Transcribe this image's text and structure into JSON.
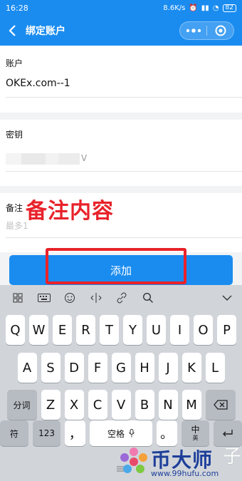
{
  "status_bar": {
    "time": "16:28",
    "net_speed": "8.6K/s",
    "battery": "82"
  },
  "header": {
    "title": "绑定账户"
  },
  "form": {
    "account": {
      "label": "账户",
      "value": "OKEx.com--1"
    },
    "secret": {
      "label": "密钥",
      "value_suffix": "V"
    },
    "note": {
      "label": "备注",
      "placeholder": "最多1"
    }
  },
  "annotation": {
    "text": "备注内容"
  },
  "submit": {
    "label": "添加"
  },
  "keyboard": {
    "row1": [
      "Q",
      "W",
      "E",
      "R",
      "T",
      "Y",
      "U",
      "I",
      "O",
      "P"
    ],
    "row2": [
      "A",
      "S",
      "D",
      "F",
      "G",
      "H",
      "J",
      "K",
      "L"
    ],
    "row3": [
      "Z",
      "X",
      "C",
      "V",
      "B",
      "N",
      "M"
    ],
    "fenci": "分词",
    "symbol": "符",
    "num": "123",
    "comma": "，",
    "space": "空格",
    "period": "。",
    "zh": "中",
    "en": "英"
  },
  "watermark": {
    "brand": "币大师",
    "url": "www.99hufu.com",
    "tail": "子"
  },
  "colors": {
    "accent": "#1a8cf0",
    "annotation": "#e8222a"
  }
}
